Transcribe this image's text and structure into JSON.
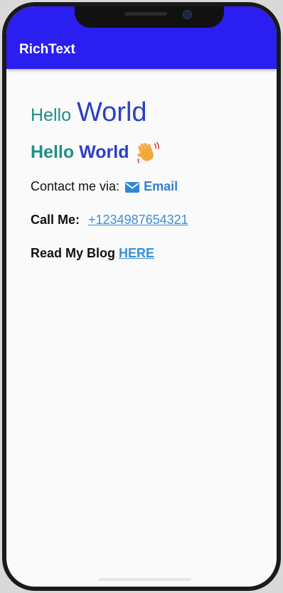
{
  "appbar": {
    "title": "RichText",
    "color": "#2a1ef0"
  },
  "content": {
    "line1": {
      "hello": "Hello",
      "world": "World"
    },
    "line2": {
      "hello": "Hello",
      "world": "World",
      "icon": "waving-hand-icon"
    },
    "line3": {
      "label": "Contact me via:",
      "icon": "mail-icon",
      "link": "Email"
    },
    "line4": {
      "label": "Call Me:",
      "link": "+1234987654321"
    },
    "line5": {
      "label": "Read My Blog",
      "link": "HERE"
    }
  },
  "colors": {
    "teal": "#1f8f85",
    "blue": "#2b3fc7",
    "link": "#3a8fd8"
  }
}
